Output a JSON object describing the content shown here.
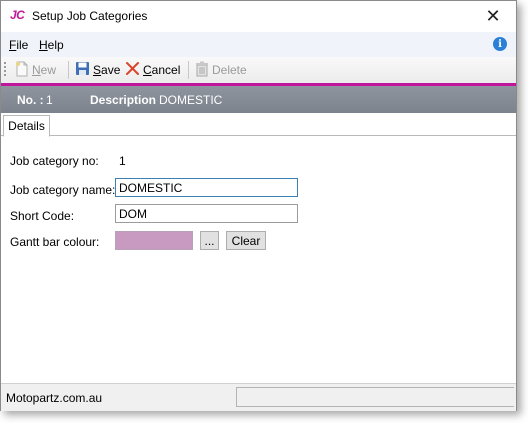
{
  "window": {
    "logo": "JC",
    "title": "Setup Job Categories",
    "close_symbol": "✕"
  },
  "menu": {
    "file_accel": "F",
    "file_rest": "ile",
    "help_accel": "H",
    "help_rest": "elp",
    "info_symbol": "i"
  },
  "toolbar": {
    "new_accel": "N",
    "new_rest": "ew",
    "save_accel": "S",
    "save_rest": "ave",
    "cancel_accel": "C",
    "cancel_rest": "ancel",
    "delete_label": "Delete"
  },
  "header": {
    "no_label": "No. :",
    "no_value": "1",
    "description_label": "Description",
    "description_value": "DOMESTIC"
  },
  "tabs": [
    "Details"
  ],
  "form": {
    "job_category_no_label": "Job category no:",
    "job_category_no_value": "1",
    "job_category_name_label": "Job category name:",
    "job_category_name_value": "DOMESTIC",
    "short_code_label": "Short Code:",
    "short_code_value": "DOM",
    "gantt_bar_colour_label": "Gantt bar colour:",
    "gantt_bar_colour": "#c89ac2",
    "browse_label": "...",
    "clear_label": "Clear"
  },
  "status": {
    "company": "Motopartz.com.au"
  },
  "colors": {
    "accent": "#c0169b",
    "header_band": "#858b95"
  }
}
